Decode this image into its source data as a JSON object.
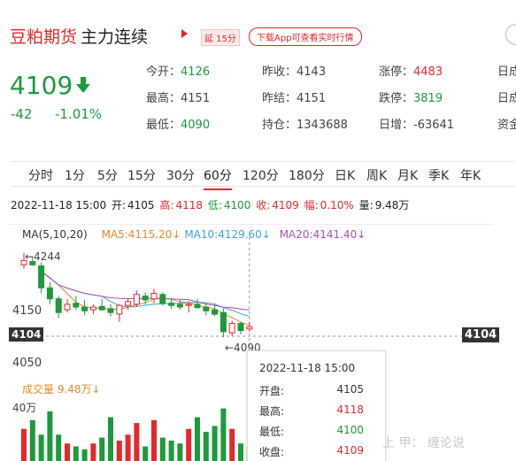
{
  "header": {
    "name": "豆粕期货",
    "subtitle": "主力连续",
    "delay_badge": "延 15分",
    "download_button": "下载App可查看实时行情"
  },
  "quote": {
    "price": "4109",
    "change": "-42",
    "change_pct": "-1.01%",
    "fields": [
      {
        "label": "今开：",
        "value": "4126",
        "color": "green"
      },
      {
        "label": "最高：",
        "value": "4151",
        "color": "plain"
      },
      {
        "label": "最低：",
        "value": "4090",
        "color": "green"
      },
      {
        "label": "昨收：",
        "value": "4143",
        "color": "plain"
      },
      {
        "label": "昨结：",
        "value": "4151",
        "color": "plain"
      },
      {
        "label": "持仓：",
        "value": "1343688",
        "color": "plain"
      },
      {
        "label": "涨停：",
        "value": "4483",
        "color": "red"
      },
      {
        "label": "跌停：",
        "value": "3819",
        "color": "green"
      },
      {
        "label": "日增：",
        "value": "-63641",
        "color": "plain"
      },
      {
        "label": "日成",
        "value": "",
        "color": "plain"
      },
      {
        "label": "日成",
        "value": "",
        "color": "plain"
      },
      {
        "label": "资金",
        "value": "",
        "color": "plain"
      }
    ]
  },
  "tabs": [
    "分时",
    "1分",
    "5分",
    "15分",
    "30分",
    "60分",
    "120分",
    "180分",
    "日K",
    "周K",
    "月K",
    "季K",
    "年K"
  ],
  "active_tab": "60分",
  "bar_info": {
    "datetime": "2022-11-18  15:00",
    "open_label": "开:",
    "open": "4105",
    "high_label": "高:",
    "high": "4118",
    "low_label": "低:",
    "low": "4100",
    "close_label": "收:",
    "close": "4109",
    "amp_label": "幅:",
    "amp": "0.10%",
    "vol_label": "量:",
    "vol": "9.48万"
  },
  "ma_legend": {
    "label": "MA(5,10,20)",
    "ma5": "MA5:4115.20↓",
    "ma10": "MA10:4129.60↓",
    "ma20": "MA20:4141.40↓"
  },
  "axis": {
    "high_mark": "←4244",
    "low_mark": "←4090",
    "tick_4150": "4150",
    "tick_4050": "4050",
    "cross_price": "4104"
  },
  "volume": {
    "legend": "成交量  9.48万↓",
    "axis_label": "40万"
  },
  "tooltip": {
    "datetime": "2022-11-18  15:00",
    "rows": [
      {
        "label": "开盘:",
        "value": "4105",
        "color": "plain"
      },
      {
        "label": "最高:",
        "value": "4118",
        "color": "red"
      },
      {
        "label": "最低:",
        "value": "4100",
        "color": "green"
      },
      {
        "label": "收盘:",
        "value": "4109",
        "color": "red"
      }
    ]
  },
  "watermark": "上 甲：  缠论说",
  "colors": {
    "up": "#e6272c",
    "down": "#1c9a3c",
    "ma5": "#e98a2a",
    "ma10": "#3aa0e0",
    "ma20": "#b04fb5"
  },
  "chart_data": {
    "type": "candlestick",
    "price_range": [
      4040,
      4250
    ],
    "candles": [
      {
        "o": 4222,
        "h": 4244,
        "l": 4215,
        "c": 4230
      },
      {
        "o": 4228,
        "h": 4238,
        "l": 4220,
        "c": 4222
      },
      {
        "o": 4220,
        "h": 4226,
        "l": 4170,
        "c": 4180
      },
      {
        "o": 4180,
        "h": 4190,
        "l": 4150,
        "c": 4160
      },
      {
        "o": 4160,
        "h": 4165,
        "l": 4125,
        "c": 4135
      },
      {
        "o": 4140,
        "h": 4160,
        "l": 4135,
        "c": 4150
      },
      {
        "o": 4152,
        "h": 4165,
        "l": 4140,
        "c": 4145
      },
      {
        "o": 4145,
        "h": 4158,
        "l": 4130,
        "c": 4138
      },
      {
        "o": 4140,
        "h": 4150,
        "l": 4132,
        "c": 4145
      },
      {
        "o": 4146,
        "h": 4160,
        "l": 4138,
        "c": 4140
      },
      {
        "o": 4142,
        "h": 4150,
        "l": 4128,
        "c": 4135
      },
      {
        "o": 4132,
        "h": 4150,
        "l": 4118,
        "c": 4148
      },
      {
        "o": 4148,
        "h": 4160,
        "l": 4140,
        "c": 4155
      },
      {
        "o": 4150,
        "h": 4175,
        "l": 4145,
        "c": 4168
      },
      {
        "o": 4165,
        "h": 4172,
        "l": 4150,
        "c": 4158
      },
      {
        "o": 4160,
        "h": 4178,
        "l": 4152,
        "c": 4170
      },
      {
        "o": 4168,
        "h": 4172,
        "l": 4148,
        "c": 4152
      },
      {
        "o": 4152,
        "h": 4160,
        "l": 4142,
        "c": 4148
      },
      {
        "o": 4150,
        "h": 4158,
        "l": 4140,
        "c": 4145
      },
      {
        "o": 4148,
        "h": 4156,
        "l": 4135,
        "c": 4150
      },
      {
        "o": 4150,
        "h": 4160,
        "l": 4142,
        "c": 4144
      },
      {
        "o": 4145,
        "h": 4152,
        "l": 4130,
        "c": 4138
      },
      {
        "o": 4140,
        "h": 4150,
        "l": 4128,
        "c": 4132
      },
      {
        "o": 4135,
        "h": 4142,
        "l": 4090,
        "c": 4100
      },
      {
        "o": 4098,
        "h": 4120,
        "l": 4092,
        "c": 4115
      },
      {
        "o": 4115,
        "h": 4118,
        "l": 4095,
        "c": 4102
      },
      {
        "o": 4105,
        "h": 4118,
        "l": 4100,
        "c": 4109
      }
    ],
    "volumes": [
      22,
      28,
      18,
      34,
      18,
      12,
      10,
      8,
      12,
      16,
      30,
      14,
      18,
      26,
      10,
      28,
      16,
      14,
      12,
      22,
      30,
      20,
      24,
      36,
      22,
      12,
      9.48
    ],
    "vol_max": 40
  }
}
